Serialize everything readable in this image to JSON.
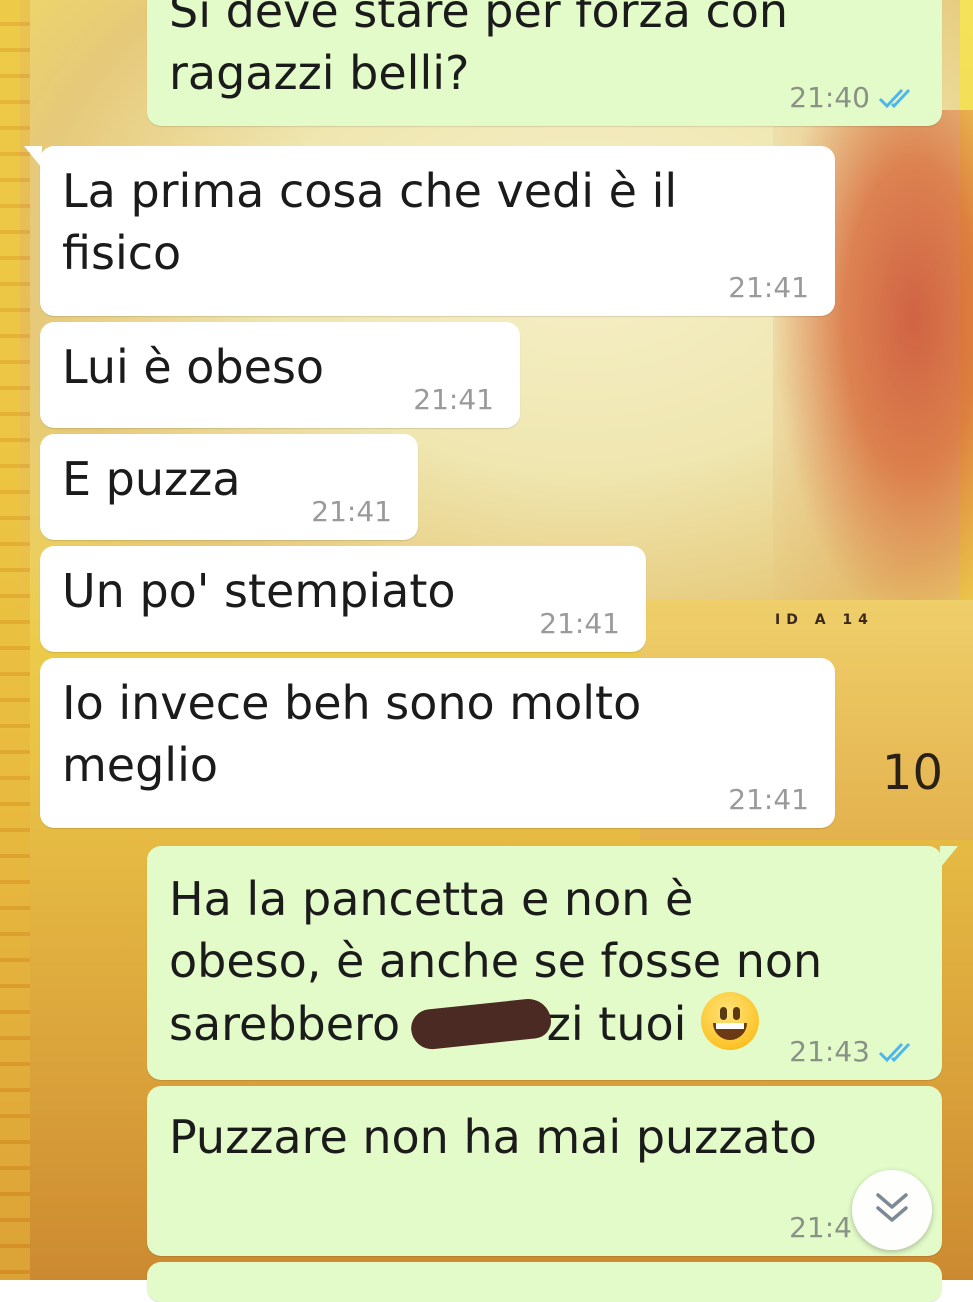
{
  "messages": [
    {
      "side": "out",
      "line1": "Si deve stare per forza con",
      "line2": "ragazzi belli?",
      "time": "21:40",
      "status": "read"
    },
    {
      "side": "in",
      "line1": "La prima cosa che vedi è il",
      "line2": "fisico",
      "time": "21:41"
    },
    {
      "side": "in",
      "text": "Lui è obeso",
      "time": "21:41"
    },
    {
      "side": "in",
      "text": "E puzza",
      "time": "21:41"
    },
    {
      "side": "in",
      "text": "Un po' stempiato",
      "time": "21:41"
    },
    {
      "side": "in",
      "line1": "Io invece beh sono molto",
      "line2": "meglio",
      "time": "21:41"
    },
    {
      "side": "out",
      "line1": "Ha la pancetta e non è",
      "line2": "obeso, è anche se fosse non",
      "line3_start": "sarebbero",
      "line3_end": "zi tuoi",
      "time": "21:43",
      "status": "read"
    },
    {
      "side": "out",
      "text": "Puzzare non ha mai puzzato",
      "time": "21:4"
    }
  ],
  "wallpaper": {
    "card_number": "10",
    "card_id": "ID A 14"
  },
  "colors": {
    "incoming_bubble": "#ffffff",
    "outgoing_bubble": "#e2fbc9",
    "read_ticks": "#4fb6ec",
    "timestamp": "#8a9287"
  },
  "icons": {
    "read_receipt": "double-check-icon",
    "scroll_down": "double-chevron-down-icon",
    "emoji": "grinning-face-emoji"
  }
}
